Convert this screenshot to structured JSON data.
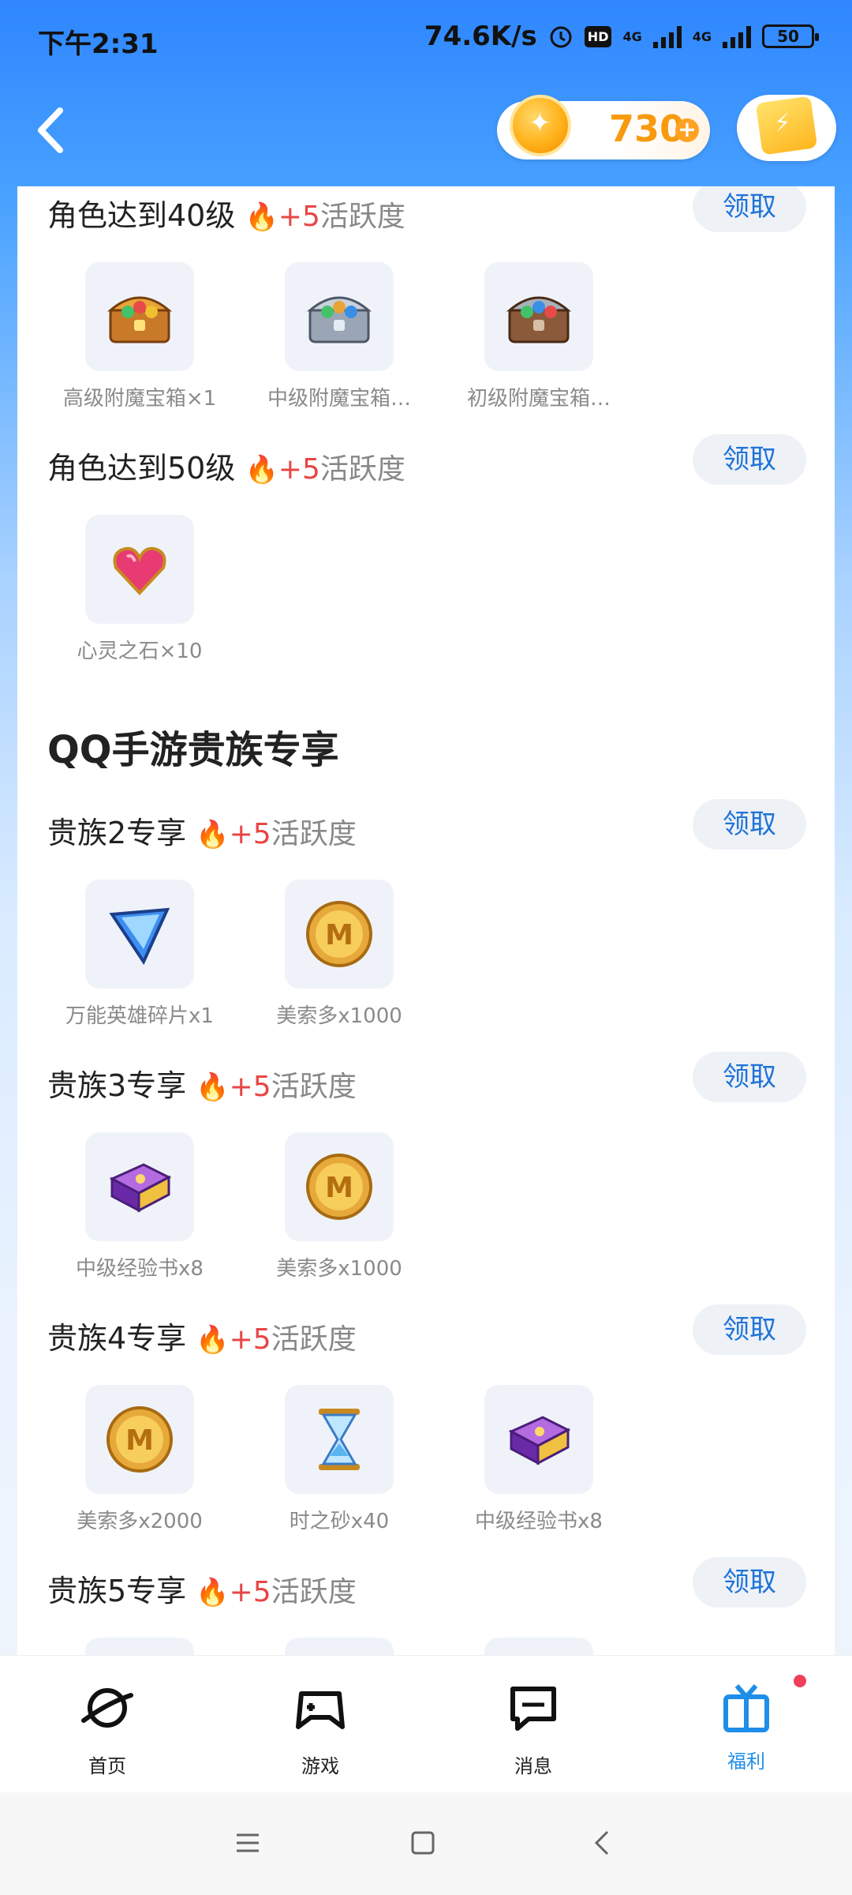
{
  "status_bar": {
    "time": "下午2:31",
    "network_speed": "74.6K/s",
    "hd": "HD",
    "net1": "4G",
    "net2": "4G",
    "battery": "50"
  },
  "header": {
    "coin_count": "730"
  },
  "level_tasks": [
    {
      "title": "角色达到40级",
      "bonus": "+5",
      "activity_label": "活跃度",
      "claim": "领取",
      "items": [
        {
          "label": "高级附魔宝箱×1",
          "icon": "treasure-chest-gold"
        },
        {
          "label": "中级附魔宝箱…",
          "icon": "treasure-chest-silver"
        },
        {
          "label": "初级附魔宝箱…",
          "icon": "treasure-chest-bronze"
        }
      ]
    },
    {
      "title": "角色达到50级",
      "bonus": "+5",
      "activity_label": "活跃度",
      "claim": "领取",
      "items": [
        {
          "label": "心灵之石×10",
          "icon": "heart-gem"
        }
      ]
    }
  ],
  "noble_section": {
    "heading": "QQ手游贵族专享",
    "tasks": [
      {
        "title": "贵族2专享",
        "bonus": "+5",
        "activity_label": "活跃度",
        "claim": "领取",
        "items": [
          {
            "label": "万能英雄碎片x1",
            "icon": "hero-shard"
          },
          {
            "label": "美索多x1000",
            "icon": "gold-coin-m"
          }
        ]
      },
      {
        "title": "贵族3专享",
        "bonus": "+5",
        "activity_label": "活跃度",
        "claim": "领取",
        "items": [
          {
            "label": "中级经验书x8",
            "icon": "purple-book"
          },
          {
            "label": "美索多x1000",
            "icon": "gold-coin-m"
          }
        ]
      },
      {
        "title": "贵族4专享",
        "bonus": "+5",
        "activity_label": "活跃度",
        "claim": "领取",
        "items": [
          {
            "label": "美索多x2000",
            "icon": "gold-coin-m"
          },
          {
            "label": "时之砂x40",
            "icon": "hourglass"
          },
          {
            "label": "中级经验书x8",
            "icon": "purple-book"
          }
        ]
      },
      {
        "title": "贵族5专享",
        "bonus": "+5",
        "activity_label": "活跃度",
        "claim": "领取",
        "items": []
      }
    ]
  },
  "tabs": [
    {
      "label": "首页",
      "icon": "planet-icon"
    },
    {
      "label": "游戏",
      "icon": "gamepad-icon"
    },
    {
      "label": "消息",
      "icon": "message-icon"
    },
    {
      "label": "福利",
      "icon": "gift-icon",
      "active": true
    }
  ],
  "colors": {
    "accent": "#1e73d8",
    "bonus": "#e84545",
    "coin": "#f79a0e",
    "active_tab": "#1e8ee8"
  }
}
